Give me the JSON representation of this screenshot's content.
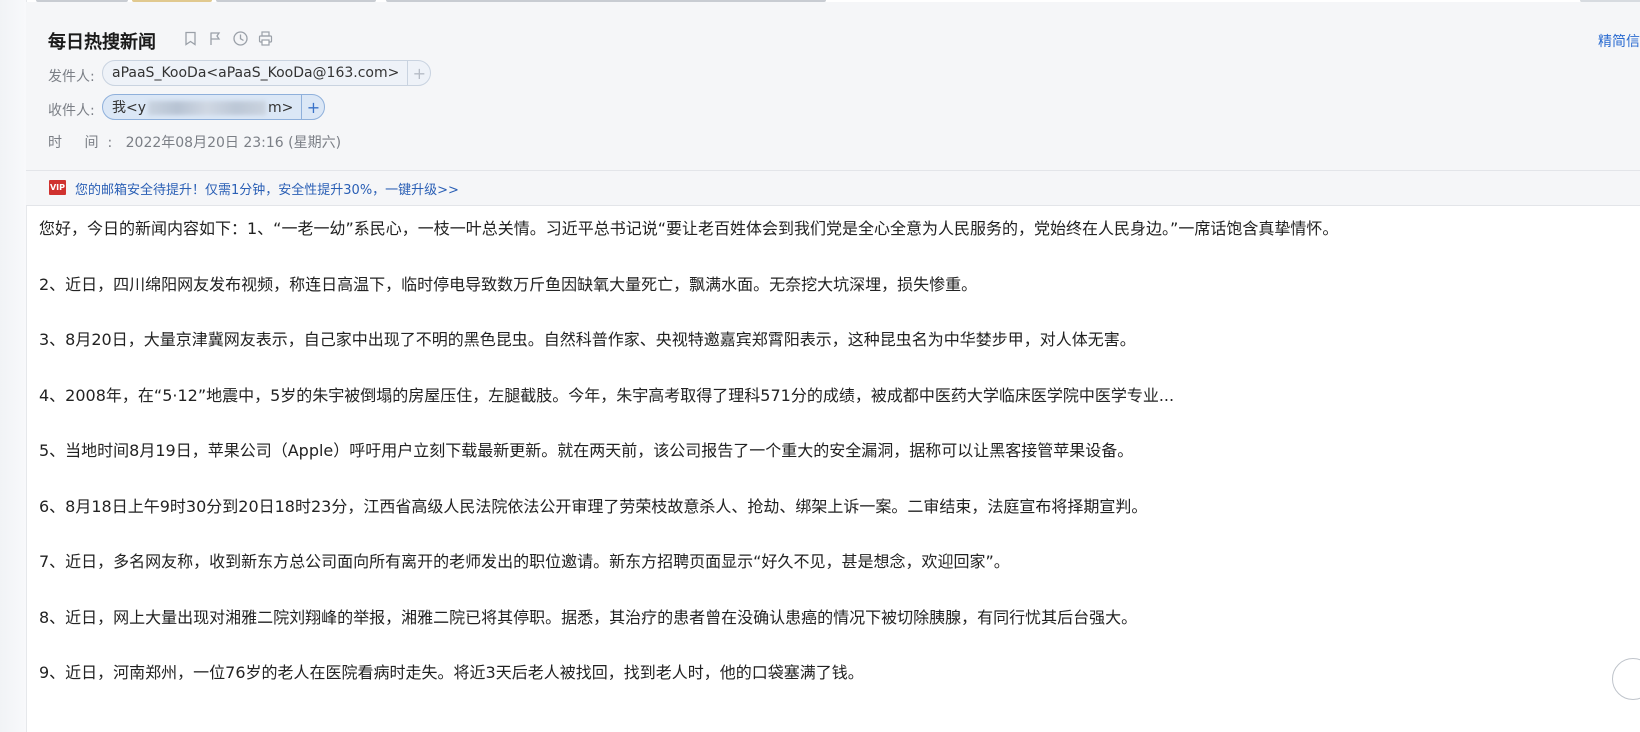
{
  "email": {
    "subject": "每日热搜新闻",
    "header_link": "精简信",
    "sender_label": "发件人:",
    "sender": "aPaaS_KooDa<aPaaS_KooDa@163.com>",
    "recipient_label": "收件人:",
    "recipient_prefix": "我<y",
    "recipient_suffix": "m>",
    "time_label": "时 间:",
    "time_value": "2022年08月20日 23:16 (星期六)",
    "plus_symbol": "+"
  },
  "notice": {
    "badge": "VIP",
    "text": "您的邮箱安全待提升！仅需1分钟，安全性提升30%，一键升级>>"
  },
  "body": {
    "paragraphs": [
      "您好，今日的新闻内容如下：1、“一老一幼”系民心，一枝一叶总关情。习近平总书记说“要让老百姓体会到我们党是全心全意为人民服务的，党始终在人民身边。”一席话饱含真挚情怀。",
      "2、近日，四川绵阳网友发布视频，称连日高温下，临时停电导致数万斤鱼因缺氧大量死亡，飘满水面。无奈挖大坑深埋，损失惨重。",
      "3、8月20日，大量京津冀网友表示，自己家中出现了不明的黑色昆虫。自然科普作家、央视特邀嘉宾郑霄阳表示，这种昆虫名为中华婪步甲，对人体无害。",
      "4、2008年，在“5·12”地震中，5岁的朱宇被倒塌的房屋压住，左腿截肢。今年，朱宇高考取得了理科571分的成绩，被成都中医药大学临床医学院中医学专业...",
      "5、当地时间8月19日，苹果公司（Apple）呼吁用户立刻下载最新更新。就在两天前，该公司报告了一个重大的安全漏洞，据称可以让黑客接管苹果设备。",
      "6、8月18日上午9时30分到20日18时23分，江西省高级人民法院依法公开审理了劳荣枝故意杀人、抢劫、绑架上诉一案。二审结束，法庭宣布将择期宣判。",
      "7、近日，多名网友称，收到新东方总公司面向所有离开的老师发出的职位邀请。新东方招聘页面显示“好久不见，甚是想念，欢迎回家”。",
      "8、近日，网上大量出现对湘雅二院刘翔峰的举报，湘雅二院已将其停职。据悉，其治疗的患者曾在没确认患癌的情况下被切除胰腺，有同行忧其后台强大。",
      "9、近日，河南郑州，一位76岁的老人在医院看病时走失。将近3天后老人被找回，找到老人时，他的口袋塞满了钱。"
    ]
  },
  "colors": {
    "link": "#2a6bd0",
    "notice_text": "#2a5fb5",
    "vip_badge": "#d0322f",
    "header_bg": "#f5f6f8"
  },
  "icons": [
    "bookmark-icon",
    "flag-icon",
    "clock-icon",
    "print-icon",
    "vip-icon",
    "plus-icon"
  ]
}
